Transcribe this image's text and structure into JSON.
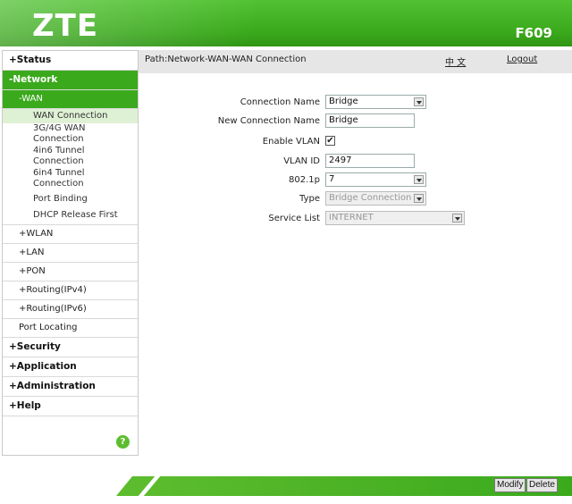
{
  "header": {
    "logo": "ZTE",
    "model": "F609"
  },
  "pathbar": {
    "path": "Path:Network-WAN-WAN Connection",
    "lang": "中 文",
    "logout": "Logout"
  },
  "sidebar": {
    "status": "+Status",
    "network": "-Network",
    "wan": "-WAN",
    "wan_items": [
      "WAN Connection",
      "3G/4G WAN Connection",
      "4in6 Tunnel Connection",
      "6in4 Tunnel Connection",
      "Port Binding",
      "DHCP Release First"
    ],
    "wlan": "+WLAN",
    "lan": "+LAN",
    "pon": "+PON",
    "routing4": "+Routing(IPv4)",
    "routing6": "+Routing(IPv6)",
    "port_locating": "Port Locating",
    "security": "+Security",
    "application": "+Application",
    "administration": "+Administration",
    "help": "+Help",
    "help_icon": "?"
  },
  "form": {
    "connection_name_label": "Connection Name",
    "connection_name_value": "Bridge",
    "new_connection_name_label": "New Connection Name",
    "new_connection_name_value": "Bridge",
    "enable_vlan_label": "Enable VLAN",
    "enable_vlan_checked": "✔",
    "vlan_id_label": "VLAN ID",
    "vlan_id_value": "2497",
    "p8021_label": "802.1p",
    "p8021_value": "7",
    "type_label": "Type",
    "type_value": "Bridge Connection",
    "service_list_label": "Service List",
    "service_list_value": "INTERNET"
  },
  "footer": {
    "modify": "Modify",
    "delete": "Delete"
  },
  "colors": {
    "brand_green": "#3aa91c",
    "light_green": "#dff1d4"
  }
}
